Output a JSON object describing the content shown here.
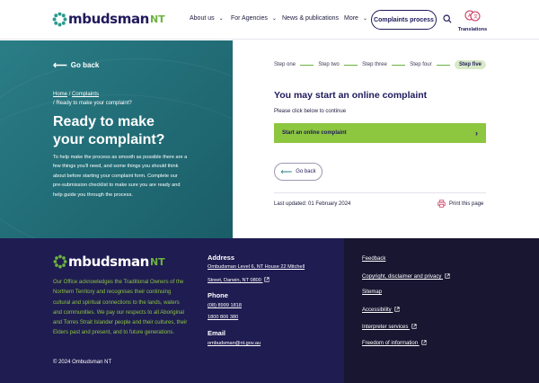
{
  "colors": {
    "navy": "#1f1a5c",
    "teal": "#2a7d86",
    "green": "#8dc63f",
    "footer_bg": "#1f1c52",
    "footer_dark": "#181631"
  },
  "header": {
    "logo_word": "mbudsman",
    "logo_suffix": "NT",
    "logo_icon": "ombudsman-sun-icon",
    "nav": [
      {
        "label": "About us",
        "has_dropdown": true
      },
      {
        "label": "For Agencies",
        "has_dropdown": true
      },
      {
        "label": "News & publications",
        "has_dropdown": false
      },
      {
        "label": "More",
        "has_dropdown": true
      }
    ],
    "complaints_button": "Complaints process",
    "search_icon": "search-icon",
    "translations_label": "Translations"
  },
  "left": {
    "go_back": "Go back",
    "breadcrumb": {
      "home": "Home",
      "complaints": "Complaints",
      "current": "Ready to make your complaint?"
    },
    "title_line1": "Ready to make",
    "title_line2": "your complaint?",
    "intro": "To help make the process as smooth as possible there are a few things you'll need, and some things you should think about before starting your complaint form. Complete our pre-submission checklist to make sure you are ready and help guide you through the process."
  },
  "right": {
    "steps": [
      "Step one",
      "Step two",
      "Step three",
      "Step four",
      "Step five"
    ],
    "active_step": 5,
    "heading": "You may start an online complaint",
    "subtext": "Please click below to continue",
    "online_button": "Start an online complaint",
    "go_back": "Go back",
    "last_updated": "Last updated: 01 February 2024",
    "print": "Print this page"
  },
  "footer": {
    "logo_word": "mbudsman",
    "logo_suffix": "NT",
    "acknowledgement": "Our Office acknowledges the Traditional Owners of the Northern Territory and recognises their continuing cultural and spiritual connections to the lands, waters and communities. We pay our respects to all Aboriginal and Torres Strait Islander people and their cultures, their Elders past and present, and to future generations.",
    "copyright": "© 2024 Ombudsman NT",
    "address_heading": "Address",
    "address_line1": "Ombudsman Level 6, NT House 22 Mitchell",
    "address_line2": "Street, Darwin, NT 0800",
    "phone_heading": "Phone",
    "phone1": "(08) 8999 1818",
    "phone2": "1800 806 380",
    "email_heading": "Email",
    "email": "ombudsman@nt.gov.au",
    "links": [
      {
        "label": "Feedback",
        "external": false
      },
      {
        "label": "Copyright, disclaimer and privacy",
        "external": true
      },
      {
        "label": "Sitemap",
        "external": false
      },
      {
        "label": "Accessibility",
        "external": true
      },
      {
        "label": "Interpreter services",
        "external": true
      },
      {
        "label": "Freedom of information",
        "external": true
      }
    ]
  }
}
